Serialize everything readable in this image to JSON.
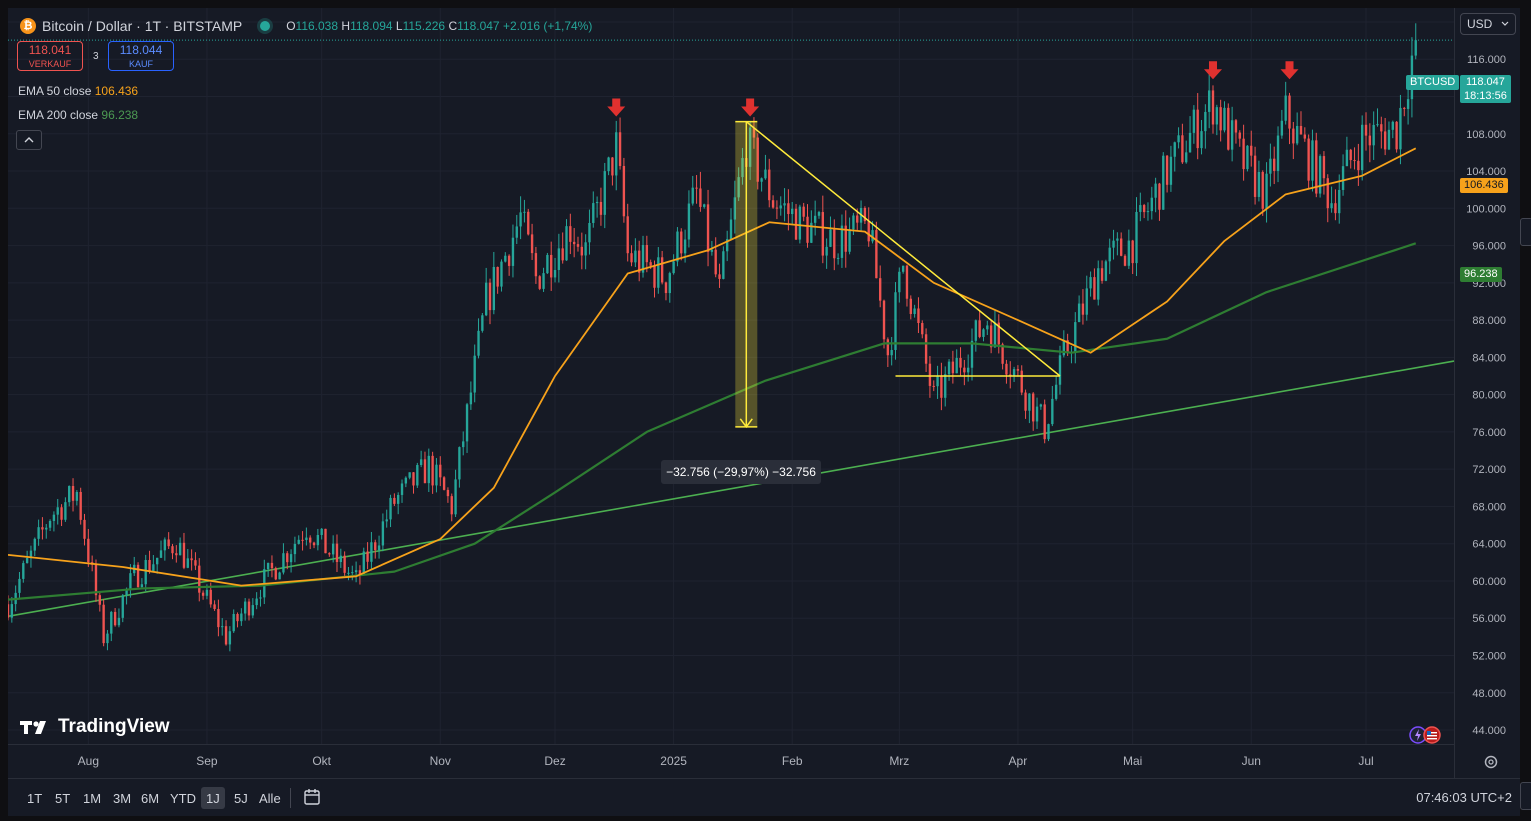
{
  "header": {
    "symbol_title": "Bitcoin / Dollar · 1T · BITSTAMP",
    "btc_icon_glyph": "₿",
    "o_label": "O",
    "o_value": "116.038",
    "h_label": "H",
    "h_value": "118.094",
    "l_label": "L",
    "l_value": "115.226",
    "c_label": "C",
    "c_value": "118.047",
    "change": "+2.016 (+1,74%)"
  },
  "trade": {
    "sell_price": "118.041",
    "sell_label": "VERKAUF",
    "spread": "3",
    "buy_price": "118.044",
    "buy_label": "KAUF"
  },
  "indicators": [
    {
      "label": "EMA 50 close",
      "value": "106.436",
      "color": "#f7a21b"
    },
    {
      "label": "EMA 200 close",
      "value": "96.238",
      "color": "#2e7d32"
    }
  ],
  "currency_button": "USD",
  "price_tags": {
    "symbol": "BTCUSD",
    "last_price": "118.047",
    "countdown": "18:13:56",
    "ema50": "106.436",
    "ema200": "96.238"
  },
  "measure_label": "−32.756 (−29,97%) −32.756",
  "logo_text": "TradingView",
  "ranges": [
    "1T",
    "5T",
    "1M",
    "3M",
    "6M",
    "YTD",
    "1J",
    "5J",
    "Alle"
  ],
  "active_range": "1J",
  "clock": "07:46:03 UTC+2",
  "colors": {
    "up": "#26a69a",
    "down": "#ef5350",
    "ema50": "#f7a21b",
    "ema200": "#2e7d32",
    "trendline": "#4caf50",
    "drawing": "#ffeb3b",
    "arrow": "#e0312f"
  },
  "chart_data": {
    "type": "candlestick",
    "interval": "1 day",
    "y_axis_ticks": [
      44000,
      48000,
      52000,
      56000,
      60000,
      64000,
      68000,
      72000,
      76000,
      80000,
      84000,
      88000,
      92000,
      96000,
      100000,
      104000,
      108000,
      112000,
      116000,
      120000
    ],
    "y_axis_labels": [
      "44.000",
      "48.000",
      "52.000",
      "56.000",
      "60.000",
      "64.000",
      "68.000",
      "72.000",
      "76.000",
      "80.000",
      "84.000",
      "88.000",
      "92.000",
      "96.000",
      "100.000",
      "104.000",
      "108.000",
      "112.000",
      "116.000",
      "120.000"
    ],
    "ylim": [
      42500,
      121500
    ],
    "x_axis_labels": [
      "Aug",
      "Sep",
      "Okt",
      "Nov",
      "Dez",
      "2025",
      "Feb",
      "Mrz",
      "Apr",
      "Mai",
      "Jun",
      "Jul"
    ],
    "x_axis_dates": [
      "2024-08-01",
      "2024-09-01",
      "2024-10-01",
      "2024-11-01",
      "2024-12-01",
      "2025-01-01",
      "2025-02-01",
      "2025-03-01",
      "2025-04-01",
      "2025-05-01",
      "2025-06-01",
      "2025-07-01"
    ],
    "xlim": [
      "2024-07-11",
      "2025-07-24"
    ],
    "last_close": 118047,
    "price_path": [
      [
        "2024-07-11",
        57500
      ],
      [
        "2024-07-22",
        67000
      ],
      [
        "2024-07-29",
        69500
      ],
      [
        "2024-08-05",
        54000
      ],
      [
        "2024-08-13",
        60500
      ],
      [
        "2024-08-24",
        64200
      ],
      [
        "2024-09-06",
        54000
      ],
      [
        "2024-09-15",
        59500
      ],
      [
        "2024-09-27",
        65800
      ],
      [
        "2024-10-10",
        60000
      ],
      [
        "2024-10-20",
        68500
      ],
      [
        "2024-10-29",
        72300
      ],
      [
        "2024-11-04",
        68000
      ],
      [
        "2024-11-13",
        90000
      ],
      [
        "2024-11-22",
        99000
      ],
      [
        "2024-11-26",
        92500
      ],
      [
        "2024-12-05",
        98000
      ],
      [
        "2024-12-09",
        95500
      ],
      [
        "2024-12-17",
        106500
      ],
      [
        "2024-12-20",
        95000
      ],
      [
        "2024-12-30",
        92500
      ],
      [
        "2025-01-07",
        101500
      ],
      [
        "2025-01-13",
        91000
      ],
      [
        "2025-01-20",
        107000
      ],
      [
        "2025-01-27",
        101000
      ],
      [
        "2025-02-03",
        98500
      ],
      [
        "2025-02-12",
        96500
      ],
      [
        "2025-02-21",
        98000
      ],
      [
        "2025-02-26",
        84500
      ],
      [
        "2025-03-02",
        94000
      ],
      [
        "2025-03-10",
        79500
      ],
      [
        "2025-03-24",
        88000
      ],
      [
        "2025-03-31",
        82500
      ],
      [
        "2025-04-08",
        76500
      ],
      [
        "2025-04-13",
        84000
      ],
      [
        "2025-04-22",
        93500
      ],
      [
        "2025-05-01",
        96500
      ],
      [
        "2025-05-10",
        104000
      ],
      [
        "2025-05-22",
        111500
      ],
      [
        "2025-05-29",
        105500
      ],
      [
        "2025-06-05",
        101500
      ],
      [
        "2025-06-10",
        110000
      ],
      [
        "2025-06-22",
        101000
      ],
      [
        "2025-06-30",
        107500
      ],
      [
        "2025-07-09",
        108500
      ],
      [
        "2025-07-14",
        118047
      ]
    ],
    "ema50": [
      [
        "2024-07-11",
        62800
      ],
      [
        "2024-08-10",
        61500
      ],
      [
        "2024-09-10",
        59500
      ],
      [
        "2024-10-10",
        60500
      ],
      [
        "2024-11-01",
        64500
      ],
      [
        "2024-11-15",
        70000
      ],
      [
        "2024-12-01",
        82000
      ],
      [
        "2024-12-20",
        93000
      ],
      [
        "2025-01-10",
        95500
      ],
      [
        "2025-01-26",
        98500
      ],
      [
        "2025-02-20",
        97500
      ],
      [
        "2025-03-10",
        92000
      ],
      [
        "2025-04-01",
        88000
      ],
      [
        "2025-04-20",
        84500
      ],
      [
        "2025-05-10",
        90000
      ],
      [
        "2025-05-25",
        96500
      ],
      [
        "2025-06-10",
        101500
      ],
      [
        "2025-06-30",
        103500
      ],
      [
        "2025-07-14",
        106436
      ]
    ],
    "ema200": [
      [
        "2024-07-11",
        58000
      ],
      [
        "2024-08-15",
        59200
      ],
      [
        "2024-09-15",
        59500
      ],
      [
        "2024-10-20",
        61000
      ],
      [
        "2024-11-10",
        64000
      ],
      [
        "2024-12-01",
        69500
      ],
      [
        "2024-12-25",
        76000
      ],
      [
        "2025-01-25",
        81500
      ],
      [
        "2025-02-25",
        85500
      ],
      [
        "2025-03-20",
        85500
      ],
      [
        "2025-04-15",
        84500
      ],
      [
        "2025-05-10",
        86000
      ],
      [
        "2025-06-05",
        91000
      ],
      [
        "2025-07-14",
        96238
      ]
    ],
    "drawings": {
      "long_trendline": [
        [
          "2024-07-11",
          56200
        ],
        [
          "2025-07-24",
          83600
        ]
      ],
      "descending_trendline": [
        [
          "2025-01-20",
          109300
        ],
        [
          "2025-04-12",
          82000
        ]
      ],
      "horizontal_support": [
        [
          "2025-02-28",
          82000
        ],
        [
          "2025-04-12",
          82000
        ]
      ],
      "price_range_measure": {
        "start": [
          "2025-01-20",
          109300
        ],
        "end": [
          "2025-01-20",
          76544
        ],
        "change": -32756,
        "percent": -29.97
      },
      "down_arrows": [
        [
          "2024-12-17",
          110500
        ],
        [
          "2025-01-21",
          110500
        ],
        [
          "2025-05-22",
          114500
        ],
        [
          "2025-06-11",
          114500
        ]
      ]
    }
  }
}
